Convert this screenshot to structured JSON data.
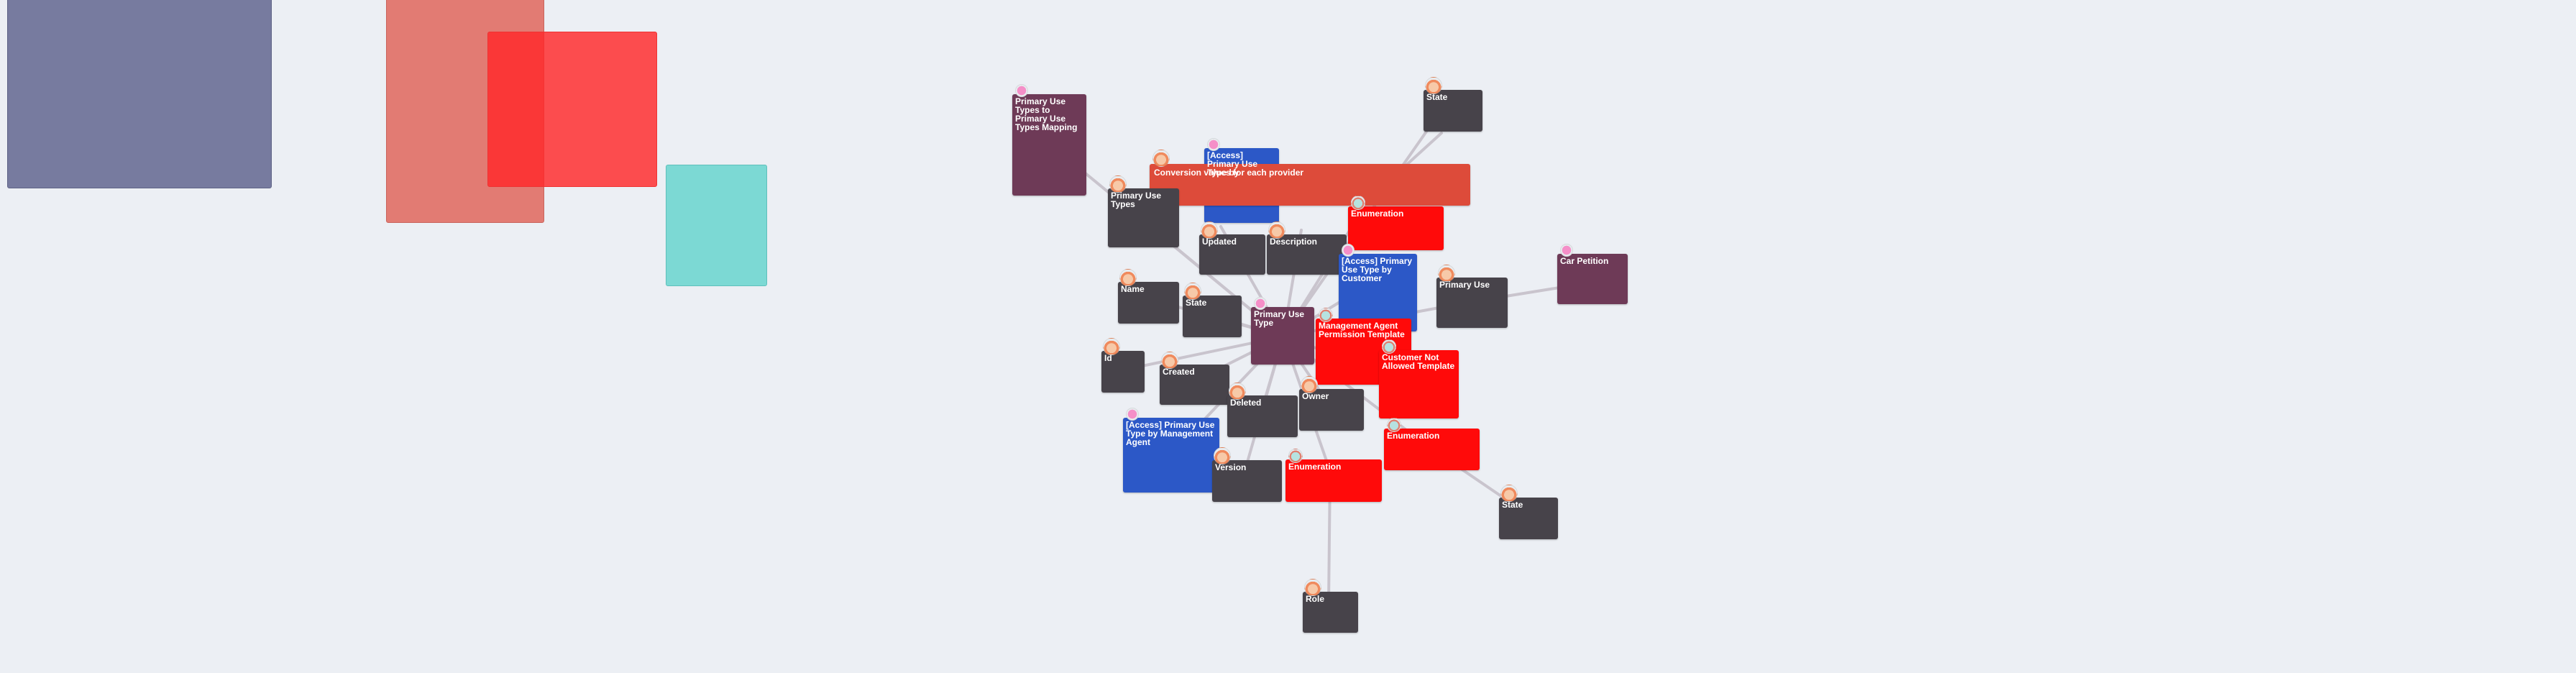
{
  "colors": {
    "background": "#eceff4",
    "attribute": "#47434a",
    "entity": "#6e3a57",
    "access": "#2c58c7",
    "enumeration": "#ff0a0a",
    "conversion": "#dd4b3a",
    "edge": "#c9c4cd",
    "panel_slate": "#777b9f",
    "panel_salmon": "#e27b73",
    "panel_red": "#ff4749",
    "panel_teal": "#7cd9d4"
  },
  "nodes": {
    "primary_use_types_mapping": {
      "label": "Primary Use Types to Primary Use Types Mapping",
      "kind": "entity"
    },
    "conversion": {
      "label": "Conversion values for each provider",
      "kind": "conversion"
    },
    "access_primary_use_top": {
      "label": "[Access] Primary Use Type by",
      "kind": "access"
    },
    "state_top": {
      "label": "State",
      "kind": "attribute"
    },
    "primary_use_types": {
      "label": "Primary Use Types",
      "kind": "attribute"
    },
    "enumeration_top": {
      "label": "Enumeration",
      "kind": "enumeration"
    },
    "updated": {
      "label": "Updated",
      "kind": "attribute"
    },
    "description": {
      "label": "Description",
      "kind": "attribute"
    },
    "access_customer": {
      "label": "[Access] Primary Use Type by Customer",
      "kind": "access"
    },
    "car_petition": {
      "label": "Car Petition",
      "kind": "entity"
    },
    "primary_use": {
      "label": "Primary Use",
      "kind": "attribute"
    },
    "name": {
      "label": "Name",
      "kind": "attribute"
    },
    "state_mid": {
      "label": "State",
      "kind": "attribute"
    },
    "primary_use_type": {
      "label": "Primary Use Type",
      "kind": "entity"
    },
    "management_template": {
      "label": "Management Agent Permission Template",
      "kind": "enumeration"
    },
    "id": {
      "label": "Id",
      "kind": "attribute"
    },
    "created": {
      "label": "Created",
      "kind": "attribute"
    },
    "customer_not_allowed": {
      "label": "Customer Not Allowed Template",
      "kind": "enumeration"
    },
    "deleted": {
      "label": "Deleted",
      "kind": "attribute"
    },
    "owner": {
      "label": "Owner",
      "kind": "attribute"
    },
    "access_management": {
      "label": "[Access] Primary Use Type by Management Agent",
      "kind": "access"
    },
    "enumeration_right": {
      "label": "Enumeration",
      "kind": "enumeration"
    },
    "version": {
      "label": "Version",
      "kind": "attribute"
    },
    "enumeration_bottom": {
      "label": "Enumeration",
      "kind": "enumeration"
    },
    "state_right": {
      "label": "State",
      "kind": "attribute"
    },
    "role": {
      "label": "Role",
      "kind": "attribute"
    }
  },
  "icons": [
    "user-avatar-icon",
    "pink-dot-icon",
    "teal-avatar-icon"
  ]
}
